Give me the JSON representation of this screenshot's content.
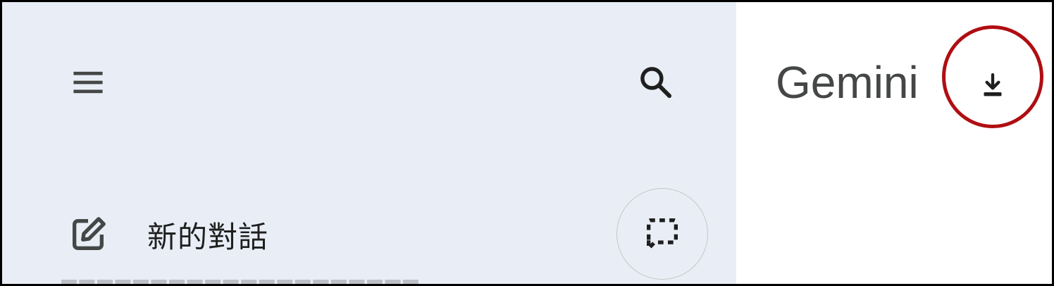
{
  "sidebar": {
    "menu_icon": "menu-icon",
    "search_icon": "search-icon",
    "new_chat": {
      "icon": "edit-icon",
      "label": "新的對話"
    },
    "temp_chat_icon": "temporary-chat-icon",
    "partial_row_text": "████████████████████"
  },
  "header": {
    "title": "Gemini",
    "download_icon": "download-icon"
  },
  "annotation": {
    "highlight_color": "#b00e12"
  },
  "colors": {
    "sidebar_bg": "#e9eef6",
    "main_bg": "#ffffff",
    "icon": "#444746",
    "text": "#1f1f1f"
  }
}
